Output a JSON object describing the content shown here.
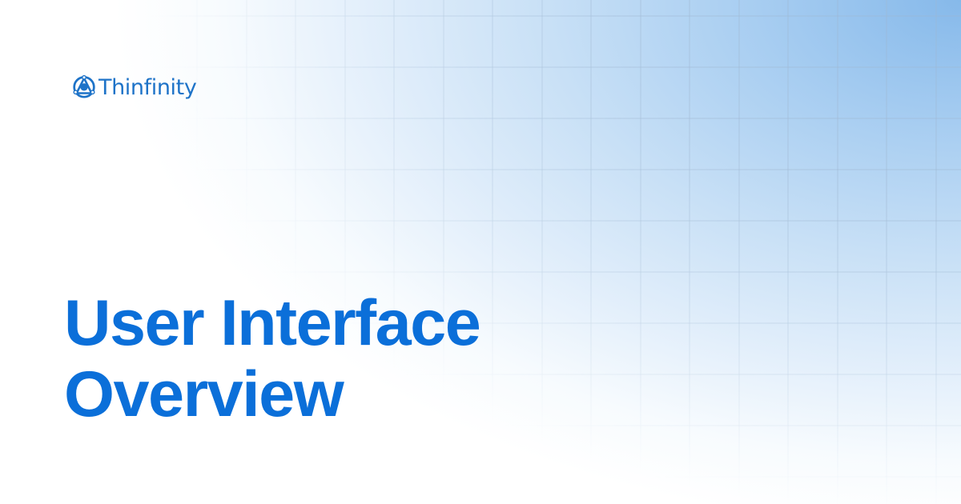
{
  "brand": {
    "name": "Thinfinity",
    "logo_icon": "thinfinity-logo-icon",
    "color": "#1e73c8"
  },
  "headline": {
    "line1": "User Interface",
    "line2": "Overview",
    "color": "#0b6fd9"
  },
  "background": {
    "accent": "#86b9ea",
    "base": "#ffffff",
    "grid_line": "#9fb6cf"
  }
}
